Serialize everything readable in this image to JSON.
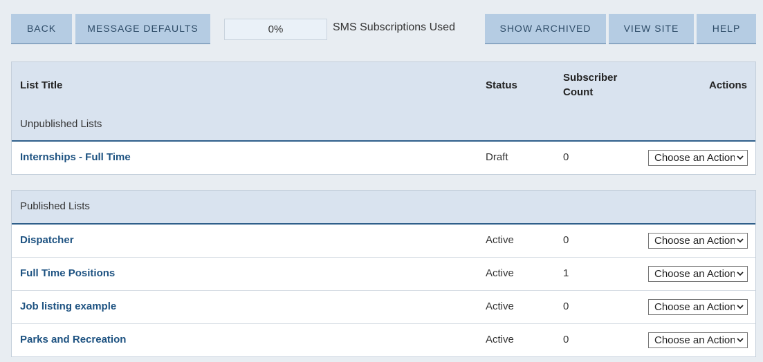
{
  "toolbar": {
    "back_label": "BACK",
    "message_defaults_label": "MESSAGE DEFAULTS",
    "sms_progress": "0%",
    "sms_progress_fraction": 0,
    "sms_label": "SMS Subscriptions Used",
    "show_archived_label": "SHOW ARCHIVED",
    "view_site_label": "VIEW SITE",
    "help_label": "HELP"
  },
  "table": {
    "columns": {
      "title": "List Title",
      "status": "Status",
      "count_line1": "Subscriber",
      "count_line2": "Count",
      "actions": "Actions"
    },
    "action_placeholder": "Choose an Action",
    "unpublished": {
      "label": "Unpublished Lists",
      "rows": [
        {
          "title": "Internships - Full Time",
          "status": "Draft",
          "count": "0"
        }
      ]
    },
    "published": {
      "label": "Published Lists",
      "rows": [
        {
          "title": "Dispatcher",
          "status": "Active",
          "count": "0"
        },
        {
          "title": "Full Time Positions",
          "status": "Active",
          "count": "1"
        },
        {
          "title": "Job listing example",
          "status": "Active",
          "count": "0"
        },
        {
          "title": "Parks and Recreation",
          "status": "Active",
          "count": "0"
        }
      ]
    }
  }
}
